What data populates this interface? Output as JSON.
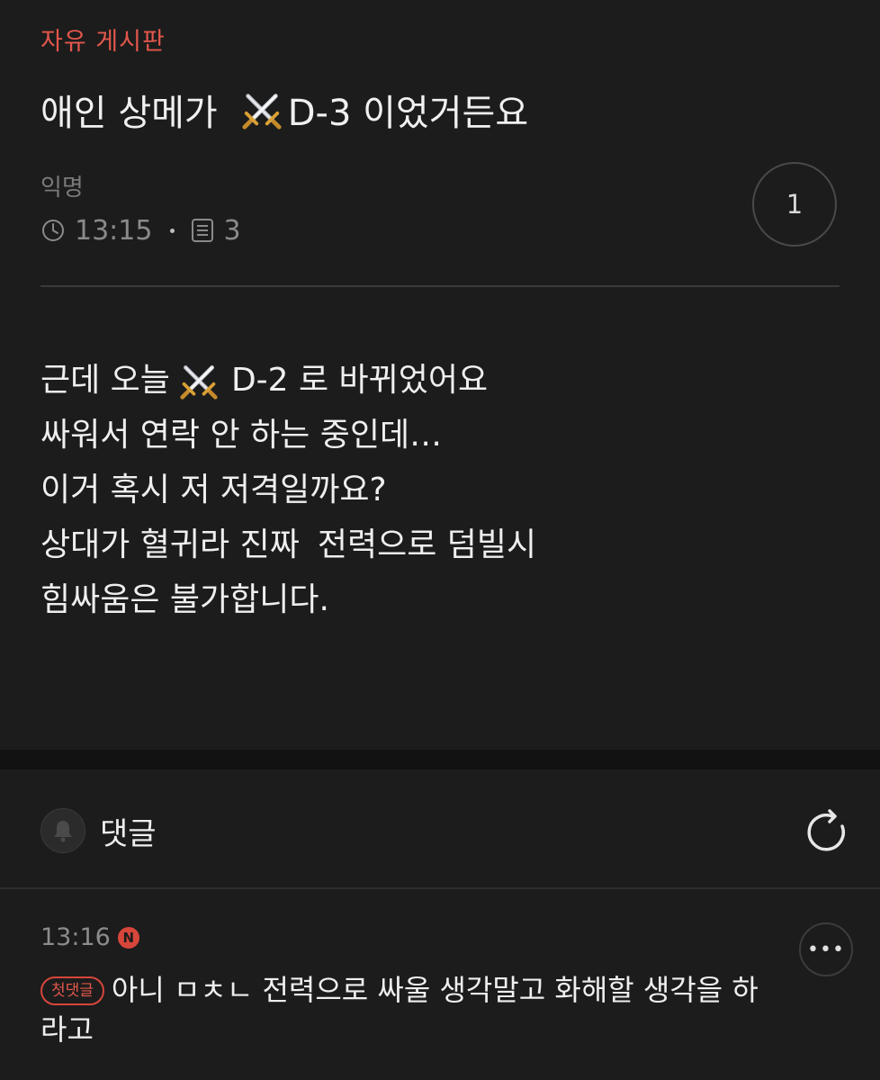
{
  "board": {
    "name": "자유 게시판"
  },
  "post": {
    "title_before": "애인 상메가",
    "title_after": "D-3 이었거든요",
    "title_emoji": "crossed-swords-icon",
    "author": "익명",
    "time": "13:15",
    "comment_count": "3",
    "like_count": "1",
    "body": {
      "line1_before": "근데 오늘",
      "line1_after": "D-2 로 바뀌었어요",
      "line2": "싸워서 연락 안 하는 중인데…",
      "line3": "이거 혹시 저 저격일까요?",
      "line4_before": "상대가 혈귀라 진짜",
      "line4_after": "전력으로 덤빌시",
      "line5": "힘싸움은 불가합니다."
    }
  },
  "comments_section": {
    "title": "댓글",
    "icons": [
      "bell-icon",
      "refresh-icon"
    ]
  },
  "comments": [
    {
      "time": "13:16",
      "new_badge": "N",
      "first_badge": "첫댓글",
      "text": "아니 ㅁㅊㄴ 전력으로 싸울 생각말고 화해할 생각을 하라고",
      "more_label": "•••"
    }
  ],
  "colors": {
    "background": "#1c1c1c",
    "accent": "#e2574c",
    "text": "#efefef",
    "muted": "#8a8a8a"
  }
}
